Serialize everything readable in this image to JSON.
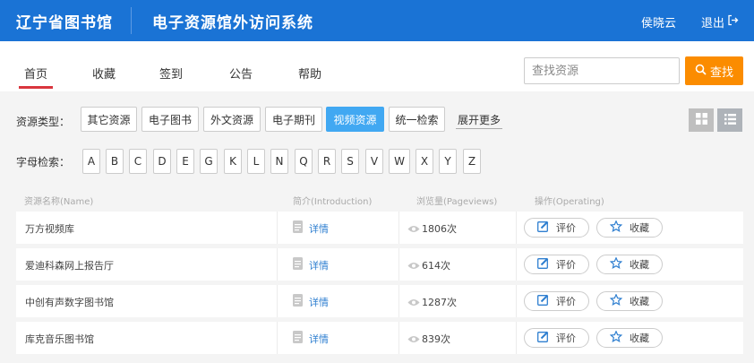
{
  "header": {
    "library_name": "辽宁省图书馆",
    "system_name": "电子资源馆外访问系统",
    "user_name": "侯晓云",
    "logout_label": "退出"
  },
  "nav": {
    "items": [
      "首页",
      "收藏",
      "签到",
      "公告",
      "帮助"
    ],
    "active_index": 0,
    "search_placeholder": "查找资源",
    "search_value": "",
    "search_button": "查找"
  },
  "filters": {
    "type_label": "资源类型：",
    "types": [
      "其它资源",
      "电子图书",
      "外文资源",
      "电子期刊",
      "视频资源",
      "统一检索"
    ],
    "active_type": "视频资源",
    "expand_label": "展开更多",
    "alpha_label": "字母检索：",
    "letters": [
      "A",
      "B",
      "C",
      "D",
      "E",
      "G",
      "K",
      "L",
      "N",
      "Q",
      "R",
      "S",
      "V",
      "W",
      "X",
      "Y",
      "Z"
    ]
  },
  "table": {
    "headers": {
      "name": "资源名称(Name)",
      "intro": "简介(Introduction)",
      "views": "浏览量(Pageviews)",
      "ops": "操作(Operating)"
    },
    "rows": [
      {
        "name": "万方视频库",
        "detail": "详情",
        "views": "1806次",
        "rate": "评价",
        "fav": "收藏"
      },
      {
        "name": "爱迪科森网上报告厅",
        "detail": "详情",
        "views": "614次",
        "rate": "评价",
        "fav": "收藏"
      },
      {
        "name": "中创有声数字图书馆",
        "detail": "详情",
        "views": "1287次",
        "rate": "评价",
        "fav": "收藏"
      },
      {
        "name": "库克音乐图书馆",
        "detail": "详情",
        "views": "839次",
        "rate": "评价",
        "fav": "收藏"
      }
    ]
  },
  "colors": {
    "header_bg": "#1a73d5",
    "search_button_bg": "#fb8c00",
    "active_type_bg": "#41a8f2",
    "active_nav_underline": "#d9363e",
    "link": "#2f7fd0"
  },
  "icons": {
    "logout": "logout-icon",
    "search": "search-icon",
    "grid_view": "grid-view-icon",
    "list_view": "list-view-icon",
    "doc": "document-icon",
    "eye": "eye-icon",
    "rate": "edit-icon",
    "fav": "star-icon"
  }
}
